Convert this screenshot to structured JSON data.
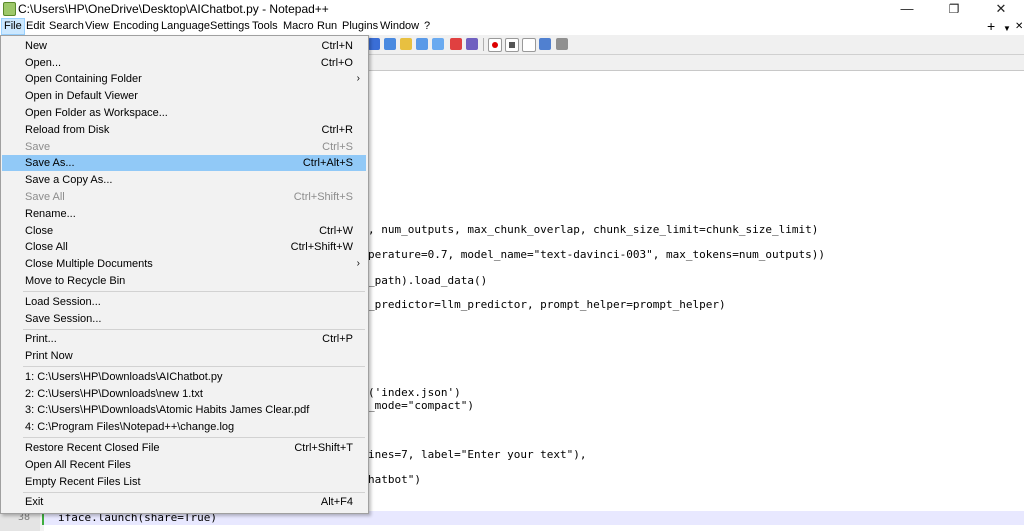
{
  "window": {
    "title": "C:\\Users\\HP\\OneDrive\\Desktop\\AIChatbot.py - Notepad++",
    "minimize": "—",
    "restore": "❐",
    "close": "✕"
  },
  "menubar": {
    "items": [
      "File",
      "Edit",
      "Search",
      "View",
      "Encoding",
      "Language",
      "Settings",
      "Tools",
      "Macro",
      "Run",
      "Plugins",
      "Window",
      "?"
    ],
    "active": "File",
    "plus": "+",
    "chevron": "▼",
    "close_doc": "✕"
  },
  "file_menu": {
    "items": [
      {
        "label": "New",
        "shortcut": "Ctrl+N"
      },
      {
        "label": "Open...",
        "shortcut": "Ctrl+O"
      },
      {
        "label": "Open Containing Folder",
        "shortcut": "",
        "submenu": true
      },
      {
        "label": "Open in Default Viewer",
        "shortcut": ""
      },
      {
        "label": "Open Folder as Workspace...",
        "shortcut": ""
      },
      {
        "label": "Reload from Disk",
        "shortcut": "Ctrl+R"
      },
      {
        "label": "Save",
        "shortcut": "Ctrl+S",
        "disabled": true
      },
      {
        "label": "Save As...",
        "shortcut": "Ctrl+Alt+S",
        "highlighted": true
      },
      {
        "label": "Save a Copy As...",
        "shortcut": ""
      },
      {
        "label": "Save All",
        "shortcut": "Ctrl+Shift+S",
        "disabled": true
      },
      {
        "label": "Rename...",
        "shortcut": ""
      },
      {
        "label": "Close",
        "shortcut": "Ctrl+W"
      },
      {
        "label": "Close All",
        "shortcut": "Ctrl+Shift+W"
      },
      {
        "label": "Close Multiple Documents",
        "shortcut": "",
        "submenu": true
      },
      {
        "label": "Move to Recycle Bin",
        "shortcut": ""
      },
      {
        "label": "Load Session...",
        "shortcut": ""
      },
      {
        "label": "Save Session...",
        "shortcut": ""
      },
      {
        "label": "Print...",
        "shortcut": "Ctrl+P"
      },
      {
        "label": "Print Now",
        "shortcut": ""
      },
      {
        "label": "1: C:\\Users\\HP\\Downloads\\AIChatbot.py",
        "shortcut": ""
      },
      {
        "label": "2: C:\\Users\\HP\\Downloads\\new 1.txt",
        "shortcut": ""
      },
      {
        "label": "3: C:\\Users\\HP\\Downloads\\Atomic Habits James Clear.pdf",
        "shortcut": ""
      },
      {
        "label": "4: C:\\Program Files\\Notepad++\\change.log",
        "shortcut": ""
      },
      {
        "label": "Restore Recent Closed File",
        "shortcut": "Ctrl+Shift+T"
      },
      {
        "label": "Open All Recent Files",
        "shortcut": ""
      },
      {
        "label": "Empty Recent Files List",
        "shortcut": ""
      },
      {
        "label": "Exit",
        "shortcut": "Alt+F4"
      }
    ],
    "submenu_arrow": "›"
  },
  "editor": {
    "code": [
      ", num_outputs, max_chunk_overlap, chunk_size_limit=chunk_size_limit)",
      "perature=0.7, model_name=\"text-davinci-003\", max_tokens=num_outputs))",
      "_path).load_data()",
      "_predictor=llm_predictor, prompt_helper=prompt_helper)",
      "('index.json')",
      "_mode=\"compact\")",
      "ines=7, label=\"Enter your text\"),",
      "hatbot\")"
    ],
    "last_line_number": "38",
    "last_line": "iface.launch(share=True)"
  },
  "colors": {
    "menu_highlight": "#91c9f7",
    "active_menu": "#cce8ff",
    "gutter": "#e4e4e4",
    "current_line": "#e8e8ff"
  }
}
